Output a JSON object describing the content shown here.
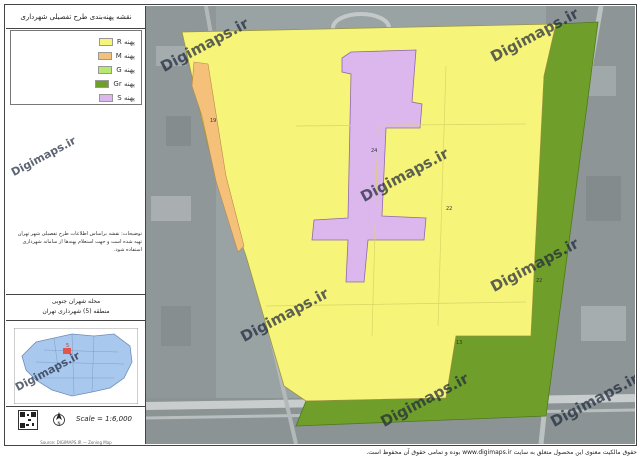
{
  "sidebar": {
    "title": "نقشه پهنه‌بندی طرح تفصیلی شهرداری",
    "legend": [
      {
        "code": "R",
        "label": "پهنه R",
        "color": "#f7f47a"
      },
      {
        "code": "M",
        "label": "پهنه M",
        "color": "#f5c07a"
      },
      {
        "code": "G",
        "label": "پهنه G",
        "color": "#b9e86e"
      },
      {
        "code": "Gr",
        "label": "پهنه Gr",
        "color": "#6f9f2a"
      },
      {
        "code": "S",
        "label": "پهنه S",
        "color": "#dcb7ee"
      }
    ],
    "notes": "توضیحات: نقشه براساس اطلاعات طرح تفصیلی شهر تهران تهیه شده است و جهت استعلام پهنه‌ها از سامانه شهرداری استفاده شود.",
    "region_line1": "محله شهران جنوبی",
    "region_line2": "منطقه (5) شهرداری تهران",
    "mini_map_label": "5",
    "scale": "Scale = 1:6,000",
    "footer_small": "Source: DIGIMAPS.IR — Zoning Map"
  },
  "map": {
    "watermark": "Digimaps.ir",
    "labels": [
      "24",
      "22",
      "22",
      "19",
      "13"
    ]
  },
  "footer_text": "حقوق مالکیت معنوی این محصول متعلق به سایت www.digimaps.ir بوده و تمامی حقوق آن محفوظ است."
}
